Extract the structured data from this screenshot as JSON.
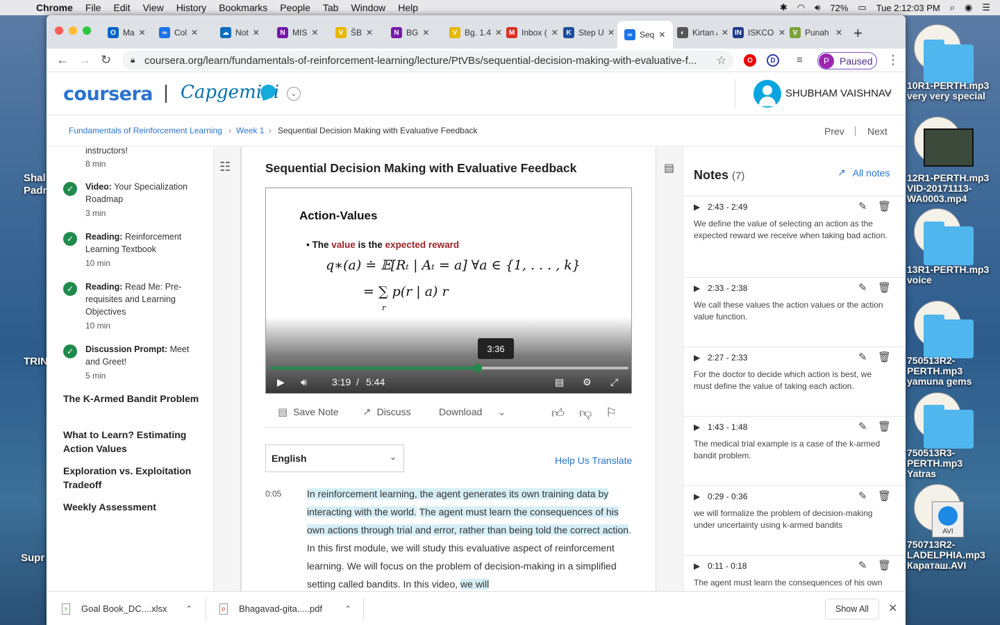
{
  "menubar": {
    "app": "Chrome",
    "items": [
      "File",
      "Edit",
      "View",
      "History",
      "Bookmarks",
      "People",
      "Tab",
      "Window",
      "Help"
    ],
    "battery": "72%",
    "clock": "Tue 2:12:03 PM"
  },
  "desktop": {
    "left_labels": [
      "Shal",
      "Padr",
      "TRIN",
      "Supr"
    ],
    "files": [
      {
        "label": "10R1-PERTH.mp3\nvery very special"
      },
      {
        "label": "12R1-PERTH.mp3\nVID-20171113-\nWA0003.mp4"
      },
      {
        "label": "13R1-PERTH.mp3\nvoice"
      },
      {
        "label": "750513R2-\nPERTH.mp3\nyamuna gems"
      },
      {
        "label": "750513R3-\nPERTH.mp3\nYatras"
      },
      {
        "label": "750713R2-\nLADELPHIA.mp3\nКараташ.AVI"
      }
    ],
    "avi_label": "AVI"
  },
  "browser": {
    "tabs": [
      {
        "title": "Ma",
        "favicon": "O",
        "color": "#0a64c8"
      },
      {
        "title": "Col",
        "favicon": "∞",
        "color": "#1a73e8"
      },
      {
        "title": "Not",
        "favicon": "☁",
        "color": "#0f6cbd"
      },
      {
        "title": "MIS",
        "favicon": "N",
        "color": "#7719aa"
      },
      {
        "title": "ŠB",
        "favicon": "V",
        "color": "#e6b800"
      },
      {
        "title": "BG",
        "favicon": "N",
        "color": "#7719aa"
      },
      {
        "title": "Bg. 1.4",
        "favicon": "V",
        "color": "#e6b800"
      },
      {
        "title": "Inbox (",
        "favicon": "M",
        "color": "#d93025"
      },
      {
        "title": "Step Up",
        "favicon": "K",
        "color": "#1b4f9c"
      },
      {
        "title": "Seq",
        "favicon": "∞",
        "color": "#1a73e8",
        "active": true
      },
      {
        "title": "Kirtan A",
        "favicon": "◐",
        "color": "#555"
      },
      {
        "title": "ISKCON",
        "favicon": "IN",
        "color": "#233a8a"
      },
      {
        "title": "Punah p",
        "favicon": "V",
        "color": "#7aa33a"
      }
    ],
    "url": "coursera.org/learn/fundamentals-of-reinforcement-learning/lecture/PtVBs/sequential-decision-making-with-evaluative-f...",
    "profile_initial": "P",
    "profile_status": "Paused",
    "ext_d": "D"
  },
  "header": {
    "logo": "coursera",
    "partner": "Capgemini",
    "user_name": "SHUBHAM VAISHNAV"
  },
  "breadcrumb": {
    "course": "Fundamentals of Reinforcement Learning",
    "week": "Week 1",
    "current": "Sequential Decision Making with Evaluative Feedback",
    "prev": "Prev",
    "next": "Next"
  },
  "sidebar": {
    "partial_item": {
      "text": "instructors!",
      "duration": "8 min"
    },
    "items": [
      {
        "type": "Video:",
        "title": "Your Specialization Roadmap",
        "duration": "3 min"
      },
      {
        "type": "Reading:",
        "title": "Reinforcement Learning Textbook",
        "duration": "10 min"
      },
      {
        "type": "Reading:",
        "title": "Read Me: Pre-requisites and Learning Objectives",
        "duration": "10 min"
      },
      {
        "type": "Discussion Prompt:",
        "title": "Meet and Greet!",
        "duration": "5 min"
      }
    ],
    "lessons": [
      "The K-Armed Bandit Problem",
      "What to Learn? Estimating Action Values",
      "Exploration vs. Exploitation Tradeoff",
      "Weekly Assessment"
    ]
  },
  "video": {
    "title": "Sequential Decision Making with Evaluative Feedback",
    "slide_heading": "Action-Values",
    "bullet_prefix": "The ",
    "bullet_value": "value",
    "bullet_mid": " is the ",
    "bullet_expected": "expected reward",
    "eq1": "q∗(a) ≐ 𝔼[Rₜ | Aₜ = a]   ∀a ∈ {1, . . . , k}",
    "eq2": "= ∑ p(r | a) r",
    "eq2_sub": "r",
    "hover_time": "3:36",
    "current_time": "3:19",
    "time_sep": "/",
    "duration": "5:44",
    "progress": 0.5785,
    "accent": "#1f8a4c"
  },
  "actions": {
    "save_note": "Save Note",
    "discuss": "Discuss",
    "download": "Download"
  },
  "language": {
    "selected": "English",
    "help_translate": "Help Us Translate"
  },
  "transcript": {
    "timestamp": "0:05",
    "seg1": "In reinforcement learning, the agent generates its own training data by interacting with the world.",
    "seg2": "The agent must learn the consequences of his own actions through trial and error, rather than being told the correct action",
    "seg3": ". In this first module, we will study this evaluative aspect of reinforcement learning. We will focus on the problem of decision-making in a simplified setting called bandits. In this video, ",
    "seg4": "we will"
  },
  "notes": {
    "title": "Notes",
    "count": "(7)",
    "all_notes": "All notes",
    "items": [
      {
        "time": "2:43 - 2:49",
        "text": "We define the value of selecting an action as the expected reward we receive when taking bad action."
      },
      {
        "time": "2:33 - 2:38",
        "text": "We call these values the action values or the action value function."
      },
      {
        "time": "2:27 - 2:33",
        "text": "For the doctor to decide which action is best, we must define the value of taking each action."
      },
      {
        "time": "1:43 - 1:48",
        "text": "The medical trial example is a case of the k-armed bandit problem."
      },
      {
        "time": "0:29 - 0:36",
        "text": "we will formalize the problem of decision-making under uncertainty using k-armed bandits"
      },
      {
        "time": "0:11 - 0:18",
        "text": "The agent must learn the consequences of his own actions through trial and error, rather than being told"
      }
    ]
  },
  "downloads": {
    "items": [
      "Goal Book_DC....xlsx",
      "Bhagavad-gita.....pdf"
    ],
    "show_all": "Show All"
  }
}
